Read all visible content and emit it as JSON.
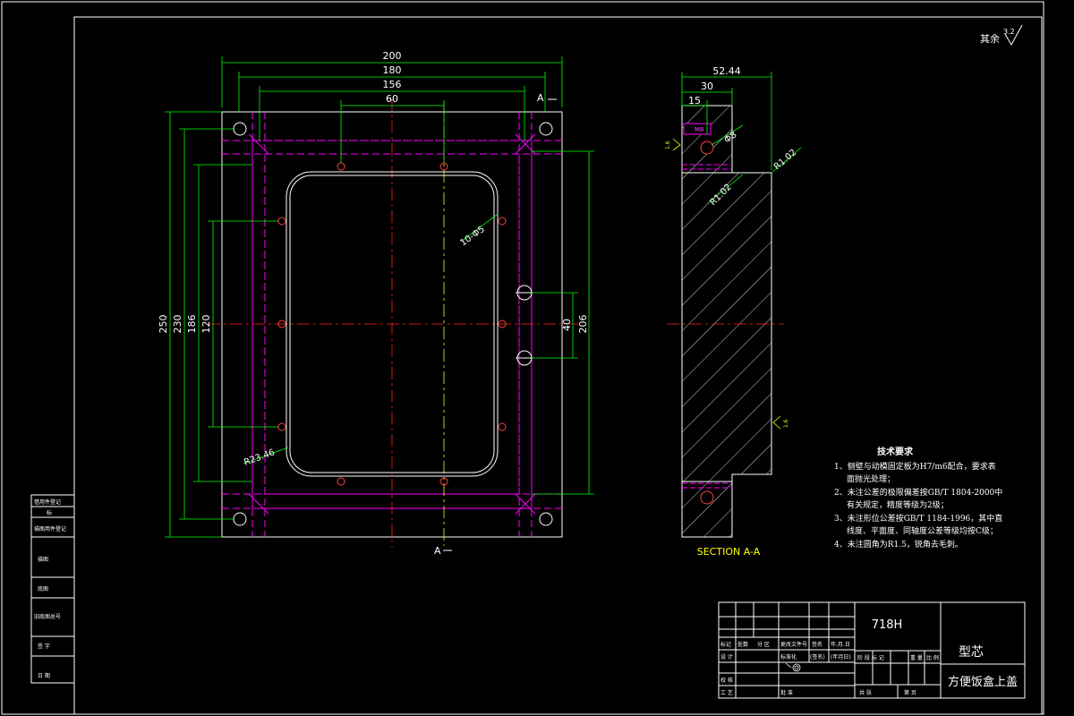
{
  "roughness": {
    "label": "其余",
    "value": "3.2"
  },
  "front_view": {
    "dims": {
      "w200": "200",
      "w180": "180",
      "w156": "156",
      "w60": "60",
      "h250": "250",
      "h230": "230",
      "h186": "186",
      "h120": "120",
      "r23": "R23.46",
      "holes": "10-Φ5",
      "s40": "40",
      "s206": "206"
    },
    "section_mark": "A"
  },
  "section_view": {
    "dims": {
      "d5244": "52.44",
      "d30": "30",
      "d15": "15",
      "m8": "M8",
      "phi8": "Φ8",
      "r102a": "R1.02",
      "r102b": "R1.02"
    },
    "title": "SECTION A-A",
    "roughness_mark": "1.6"
  },
  "tech_req": {
    "title": "技术要求",
    "items": [
      "1、侧壁与动模固定板为H7/m6配合，要求表",
      "面抛光处理；",
      "2、未注公差的极限偏差按GB/T 1804-2000中",
      "有关规定，精度等级为2级；",
      "3、未注形位公差按GB/T 1184-1996，其中直",
      "线度、平面度、同轴度公差等级均按C级；",
      "4、未注圆角为R1.5，锐角去毛刺。"
    ]
  },
  "left_strip": {
    "labels": [
      "借用件登记",
      "标",
      "描图用件登记",
      "描图",
      "底图",
      "旧底图总号",
      "签 字",
      "日 期"
    ]
  },
  "title_block": {
    "material": "718H",
    "part_type": "型芯",
    "part_name": "方便饭盒上盖",
    "rev_headers": [
      "标记",
      "处数",
      "分 区",
      "更改文件号",
      "签名",
      "年.月.日"
    ],
    "row_labels": [
      "设 计",
      "校 核",
      "审 核",
      "工 艺"
    ],
    "std_labels": [
      "标准化",
      "(签名)",
      "(年月日)"
    ],
    "stage_headers": [
      "阶 段 标 记",
      "重 量",
      "比 例"
    ],
    "sheet_labels": [
      "共 张",
      "第 页"
    ],
    "approve": "批 准"
  },
  "colors": {
    "outline": "#ffffff",
    "center": "#ff2020",
    "hidden": "#ff00ff",
    "dim": "#00ff00",
    "text": "#00ffff",
    "hatch": "#ffffff",
    "yellow": "#ffff00"
  }
}
